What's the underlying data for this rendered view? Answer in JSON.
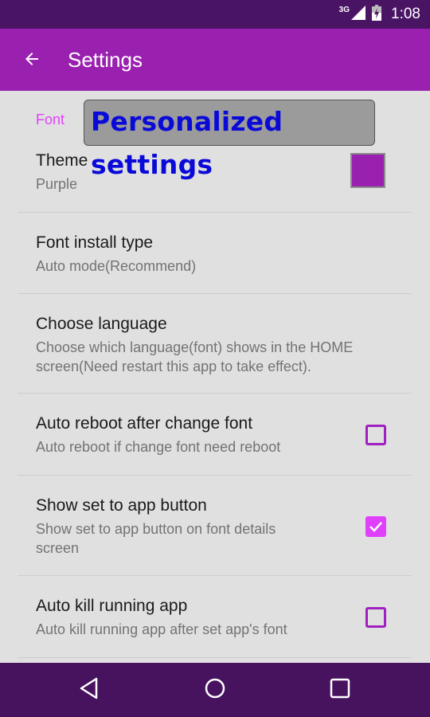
{
  "status_bar": {
    "network_type": "3G",
    "signal_icon": "cellular-signal-icon",
    "battery_icon": "battery-charging-icon",
    "time": "1:08"
  },
  "app_bar": {
    "back_icon": "arrow-back-icon",
    "title": "Settings"
  },
  "overlay": {
    "text": "Personalized settings"
  },
  "category": {
    "label": "Font"
  },
  "preferences": [
    {
      "title": "Theme",
      "summary": "Purple",
      "widget": "color-swatch",
      "color": "#9a20b0"
    },
    {
      "title": "Font install type",
      "summary": "Auto mode(Recommend)",
      "widget": "none"
    },
    {
      "title": "Choose language",
      "summary": "Choose which language(font) shows in the HOME screen(Need restart this app to take effect).",
      "widget": "none"
    },
    {
      "title": "Auto reboot after change font",
      "summary": "Auto reboot if change font need reboot",
      "widget": "checkbox",
      "checked": false
    },
    {
      "title": "Show set to app button",
      "summary": "Show set to app button on font details screen",
      "widget": "checkbox",
      "checked": true
    },
    {
      "title": "Auto kill running app",
      "summary": "Auto kill running app after set app's font",
      "widget": "checkbox",
      "checked": false
    }
  ],
  "nav_bar": {
    "back": "nav-back-icon",
    "home": "nav-home-icon",
    "recents": "nav-recents-icon"
  },
  "colors": {
    "primary": "#9a20b0",
    "primary_dark": "#4a1465",
    "accent": "#e040fb",
    "overlay_text": "#0a0ad8"
  }
}
